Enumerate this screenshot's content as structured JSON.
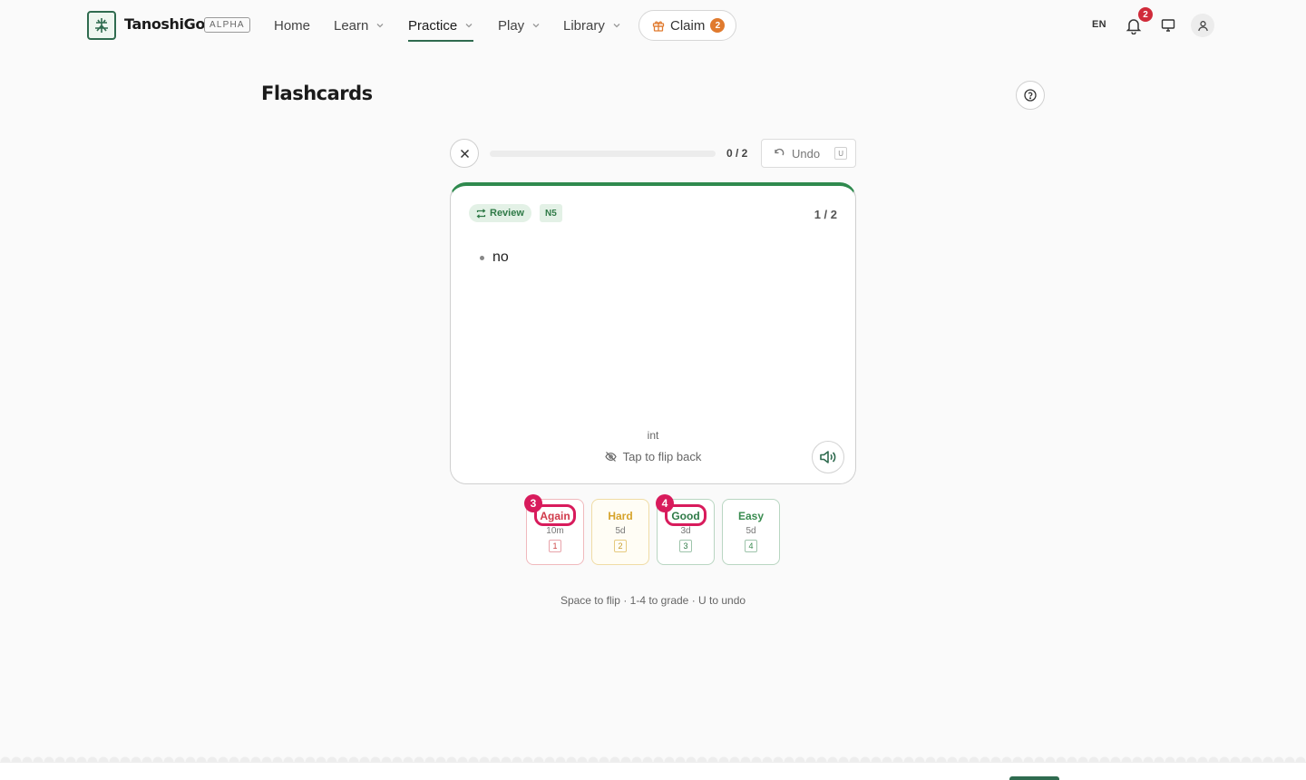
{
  "header": {
    "brand": "TanoshiGo",
    "badge": "ALPHA",
    "nav": {
      "home": "Home",
      "learn": "Learn",
      "practice": "Practice",
      "play": "Play",
      "library": "Library"
    },
    "claim": {
      "label": "Claim",
      "count": "2"
    },
    "language": "EN",
    "notifications_count": "2"
  },
  "page": {
    "title": "Flashcards"
  },
  "session": {
    "progress_text": "0 / 2",
    "progress_fraction": 0,
    "undo_label": "Undo",
    "undo_key": "U"
  },
  "card": {
    "tag": "Review",
    "level": "N5",
    "index": "1 / 2",
    "meanings": [
      "no"
    ],
    "part_of_speech": "int",
    "flip_hint": "Tap to flip back"
  },
  "grades": {
    "again": {
      "label": "Again",
      "interval": "10m",
      "key": "1"
    },
    "hard": {
      "label": "Hard",
      "interval": "5d",
      "key": "2"
    },
    "good": {
      "label": "Good",
      "interval": "3d",
      "key": "3"
    },
    "easy": {
      "label": "Easy",
      "interval": "5d",
      "key": "4"
    }
  },
  "annotations": {
    "again_marker": "3",
    "good_marker": "4"
  },
  "shortcut_hint": "Space to flip · 1-4 to grade · U to undo",
  "colors": {
    "brand_green": "#2f6b4f",
    "accent_green": "#2f8a4e",
    "again_red": "#d03a4a",
    "hard_amber": "#d6a32a",
    "annotation_pink": "#d81b5c",
    "claim_orange": "#e07a2e"
  }
}
